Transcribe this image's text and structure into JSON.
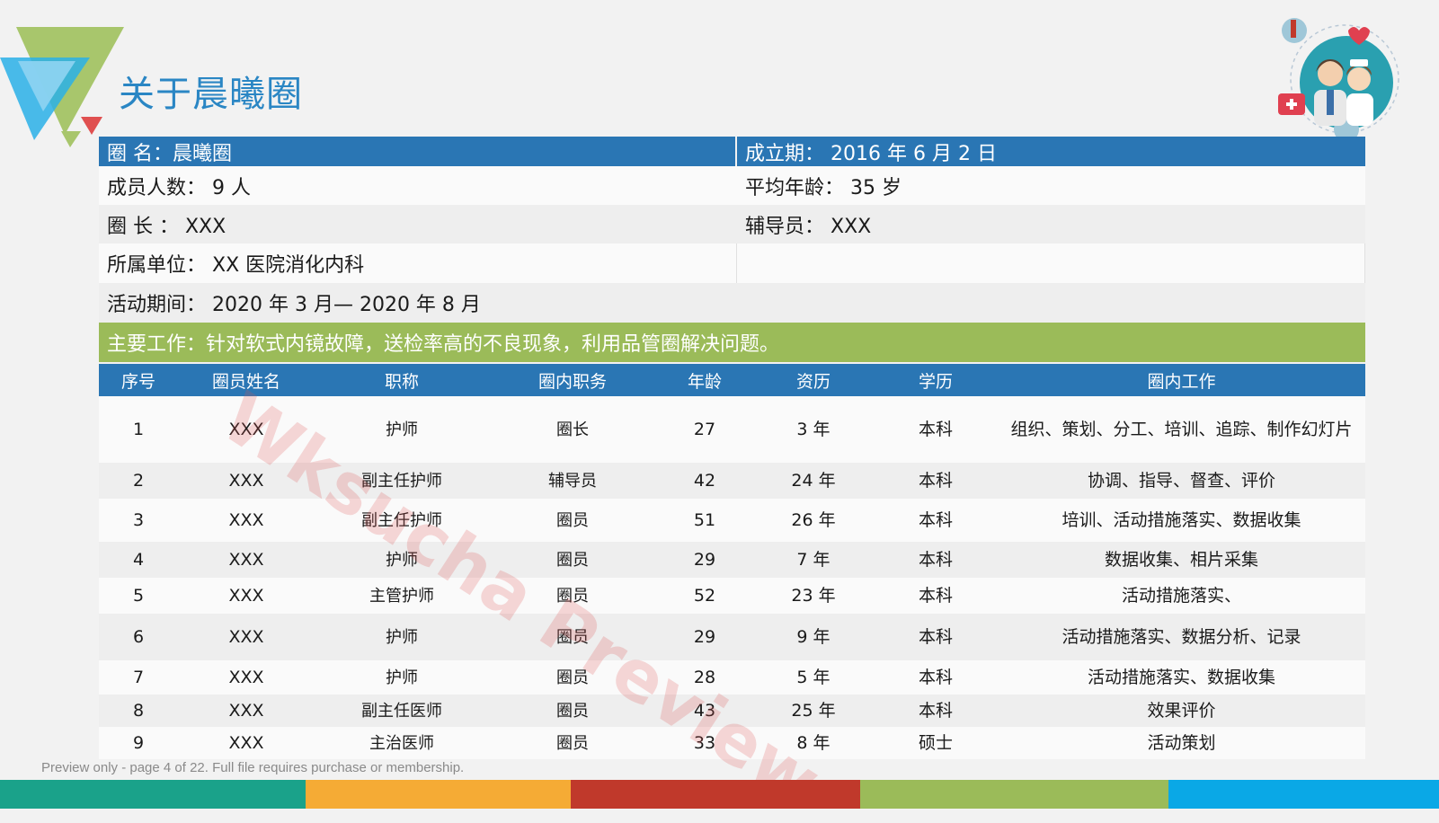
{
  "title": "关于晨曦圈",
  "info": {
    "circle_name": "圈 名：晨曦圈",
    "established": "成立期： 2016 年 6 月 2 日",
    "member_count": "成员人数： 9 人",
    "avg_age": "平均年龄： 35 岁",
    "leader": "圈 长 ： XXX",
    "counselor": "辅导员： XXX",
    "unit": "所属单位： XX 医院消化内科",
    "period": "活动期间： 2020 年 3 月— 2020 年 8 月",
    "main_work": "主要工作：针对软式内镜故障，送检率高的不良现象，利用品管圈解决问题。"
  },
  "table": {
    "headers": [
      "序号",
      "圈员姓名",
      "职称",
      "圈内职务",
      "年龄",
      "资历",
      "学历",
      "圈内工作"
    ],
    "rows": [
      [
        "1",
        "XXX",
        "护师",
        "圈长",
        "27",
        "3 年",
        "本科",
        "组织、策划、分工、培训、追踪、制作幻灯片"
      ],
      [
        "2",
        "XXX",
        "副主任护师",
        "辅导员",
        "42",
        "24 年",
        "本科",
        "协调、指导、督查、评价"
      ],
      [
        "3",
        "XXX",
        "副主任护师",
        "圈员",
        "51",
        "26 年",
        "本科",
        "培训、活动措施落实、数据收集"
      ],
      [
        "4",
        "XXX",
        "护师",
        "圈员",
        "29",
        "7 年",
        "本科",
        "数据收集、相片采集"
      ],
      [
        "5",
        "XXX",
        "主管护师",
        "圈员",
        "52",
        "23 年",
        "本科",
        "活动措施落实、"
      ],
      [
        "6",
        "XXX",
        "护师",
        "圈员",
        "29",
        "9 年",
        "本科",
        "活动措施落实、数据分析、记录"
      ],
      [
        "7",
        "XXX",
        "护师",
        "圈员",
        "28",
        "5 年",
        "本科",
        "活动措施落实、数据收集"
      ],
      [
        "8",
        "XXX",
        "副主任医师",
        "圈员",
        "43",
        "25 年",
        "本科",
        "效果评价"
      ],
      [
        "9",
        "XXX",
        "主治医师",
        "圈员",
        "33",
        "8 年",
        "硕士",
        "活动策划"
      ]
    ]
  },
  "watermark": "Wksucha Preview",
  "preview_note": "Preview only - page 4 of 22. Full file requires purchase or membership.",
  "colors": {
    "title": "#2a86c4",
    "header_blue": "#2a76b4",
    "highlight_green": "#9bbb59",
    "footer_bar": [
      "#1aa28a",
      "#f5ab35",
      "#c0392b",
      "#9bbb59",
      "#0aa8e6"
    ]
  }
}
